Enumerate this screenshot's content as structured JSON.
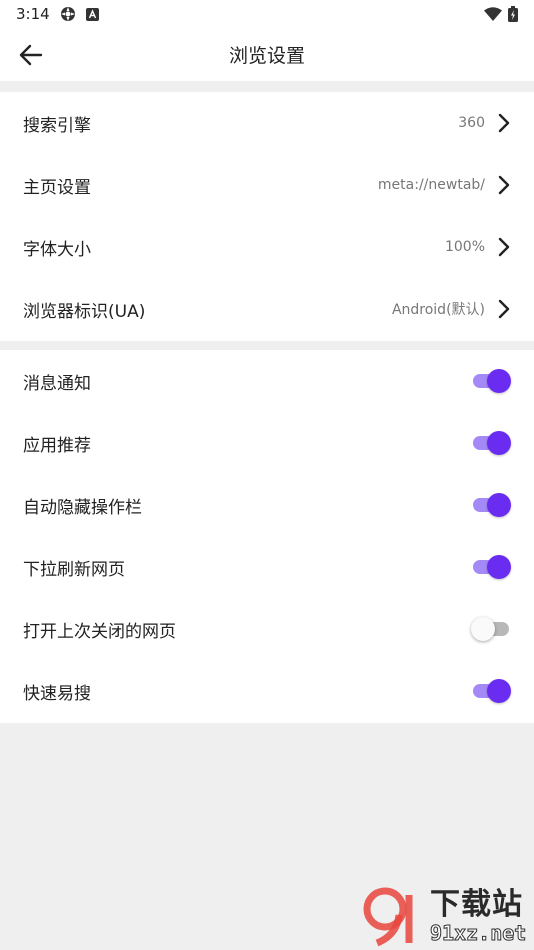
{
  "status_bar": {
    "time": "3:14",
    "icons_left": [
      "settings-icon",
      "text-app-icon"
    ],
    "icons_right": [
      "wifi-icon",
      "battery-icon"
    ]
  },
  "app_bar": {
    "title": "浏览设置",
    "back_icon": "arrow-left-icon"
  },
  "settings_group_1": [
    {
      "label": "搜索引擎",
      "value": "360"
    },
    {
      "label": "主页设置",
      "value": "meta://newtab/"
    },
    {
      "label": "字体大小",
      "value": "100%"
    },
    {
      "label": "浏览器标识(UA)",
      "value": "Android(默认)"
    }
  ],
  "settings_group_2": [
    {
      "label": "消息通知",
      "enabled": true
    },
    {
      "label": "应用推荐",
      "enabled": true
    },
    {
      "label": "自动隐藏操作栏",
      "enabled": true
    },
    {
      "label": "下拉刷新网页",
      "enabled": true
    },
    {
      "label": "打开上次关闭的网页",
      "enabled": false
    },
    {
      "label": "快速易搜",
      "enabled": true
    }
  ],
  "watermark": {
    "main_text": "下载站",
    "url_text": "91xz.net"
  },
  "colors": {
    "accent": "#6a2cf0",
    "accent_track": "#a48af7",
    "background": "#efefef"
  }
}
